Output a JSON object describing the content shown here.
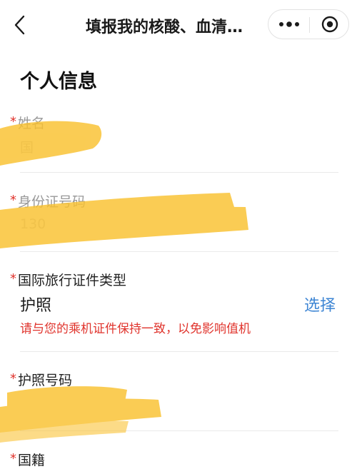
{
  "nav": {
    "title": "填报我的核酸、血清…",
    "back_icon": "chevron-left-icon",
    "more_icon": "more-dots-icon",
    "close_icon": "target-close-icon"
  },
  "section_title": "个人信息",
  "required_mark": "*",
  "fields": {
    "name": {
      "label": "姓名",
      "value": "国"
    },
    "id_number": {
      "label": "身份证号码",
      "value": "130"
    },
    "travel_doc_type": {
      "label": "国际旅行证件类型",
      "value": "护照",
      "action": "选择",
      "hint": "请与您的乘机证件保持一致，以免影响值机"
    },
    "passport_number": {
      "label": "护照号码"
    },
    "nationality": {
      "label": "国籍"
    }
  },
  "colors": {
    "required": "#e0342d",
    "link": "#3e86d4",
    "redaction": "#f9c12f"
  }
}
